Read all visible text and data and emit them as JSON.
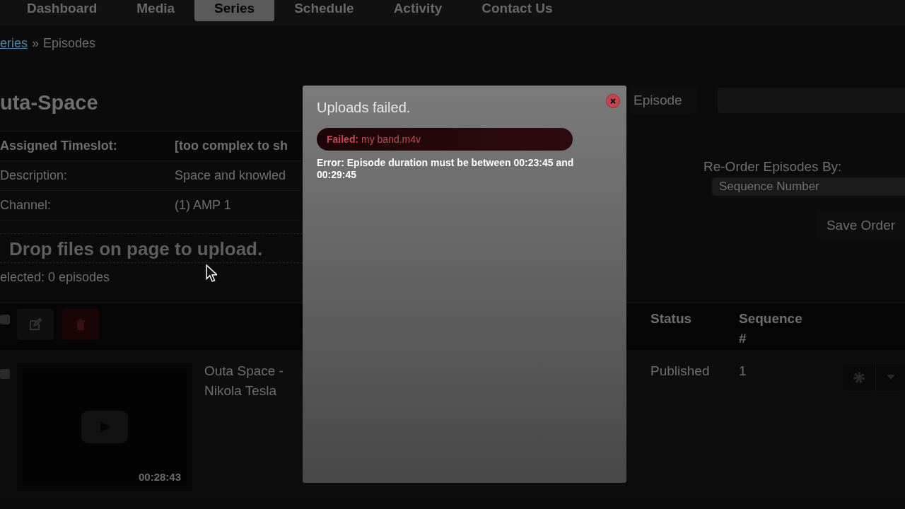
{
  "nav": {
    "tabs": [
      {
        "label": "Dashboard",
        "selected": false
      },
      {
        "label": "Media",
        "selected": false
      },
      {
        "label": "Series",
        "selected": true
      },
      {
        "label": "Schedule",
        "selected": false
      },
      {
        "label": "Activity",
        "selected": false
      },
      {
        "label": "Contact Us",
        "selected": false
      }
    ]
  },
  "breadcrumb": {
    "link": "eries",
    "separator": "»",
    "current": "Episodes"
  },
  "title": "uta-Space",
  "details": [
    {
      "label": "Assigned Timeslot:",
      "value": "[too complex to sh",
      "emphasis": true
    },
    {
      "label": "Description:",
      "value": "Space and knowled",
      "emphasis": false
    },
    {
      "label": "Channel:",
      "value": "(1) AMP 1",
      "emphasis": false
    }
  ],
  "drop_zone": "Drop files on page to upload.",
  "selected_count": "elected: 0 episodes",
  "new_button": "Episode",
  "reorder": {
    "label": "Re-Order Episodes By:",
    "value": "Sequence Number",
    "save_button": "Save Order"
  },
  "table": {
    "header_checked": false,
    "columns": [
      "Status",
      "Sequence #"
    ],
    "rows": [
      {
        "checked": false,
        "duration": "00:28:43",
        "title": "Outa Space - Nikola Tesla",
        "status": "Published",
        "sequence": "1"
      }
    ]
  },
  "modal": {
    "title": "Uploads failed.",
    "failures": [
      "**Failed:** my band.m4v"
    ],
    "error": "Error: Episode duration must be between 00:23:45 and 00:29:45"
  }
}
